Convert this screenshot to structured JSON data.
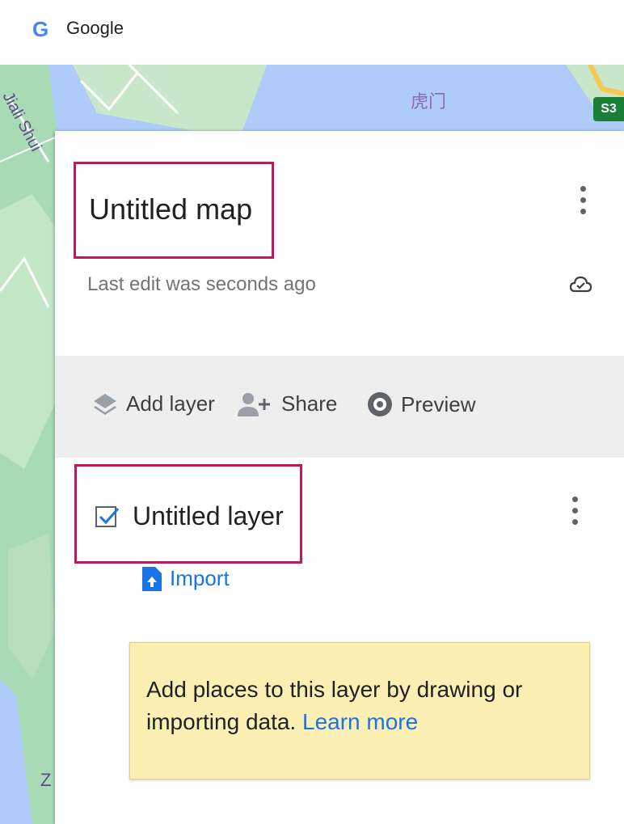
{
  "header": {
    "brand": "Google"
  },
  "map": {
    "labels": {
      "top_place": "虎门",
      "left_street": "Jiali Shui",
      "bottom_left": "Z",
      "shield": "S3"
    }
  },
  "panel": {
    "title": "Untitled map",
    "last_edit": "Last edit was seconds ago",
    "toolbar": {
      "add_layer": "Add layer",
      "share": "Share",
      "preview": "Preview"
    },
    "layer": {
      "name": "Untitled layer",
      "checked": true,
      "import_label": "Import"
    },
    "tooltip": {
      "text": "Add places to this layer by drawing or importing data.",
      "link": "Learn more"
    }
  },
  "colors": {
    "highlight_box": "#c2185b",
    "link": "#1a73e8",
    "tooltip_bg": "#fcefb4"
  },
  "icons": [
    "google-g-icon",
    "more-vert-icon",
    "cloud-saved-icon",
    "layers-icon",
    "person-add-icon",
    "preview-eye-icon",
    "checkbox-checked-icon",
    "import-file-icon"
  ]
}
